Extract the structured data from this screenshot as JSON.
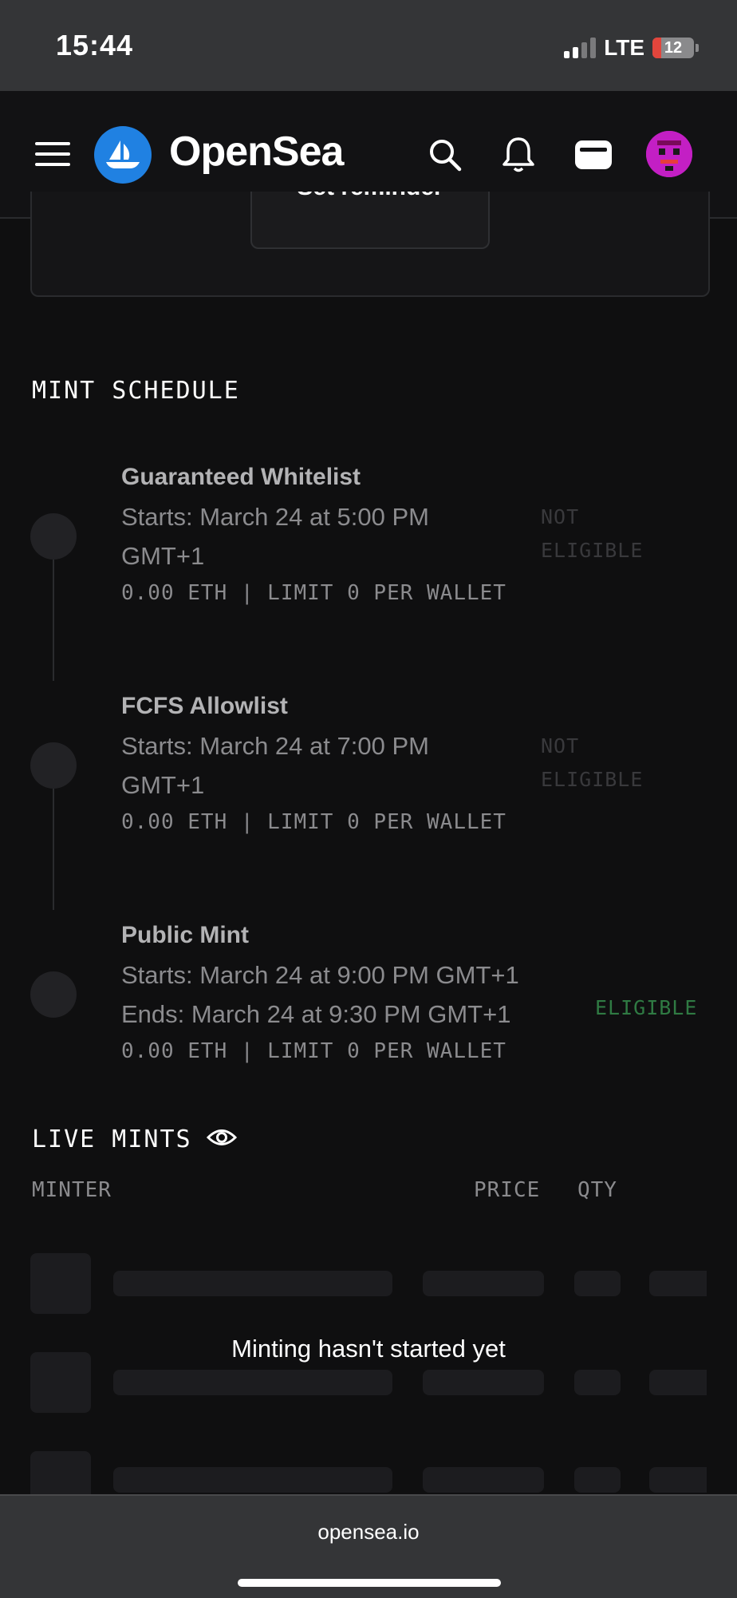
{
  "status_bar": {
    "time": "15:44",
    "network": "LTE",
    "battery": "12"
  },
  "nav": {
    "brand": "OpenSea",
    "icons": [
      "menu-icon",
      "search-icon",
      "bell-icon",
      "wallet-icon",
      "avatar"
    ]
  },
  "reminder": {
    "button_label": "Set reminder"
  },
  "mint_schedule": {
    "title": "MINT SCHEDULE",
    "phases": [
      {
        "name": "Guaranteed Whitelist",
        "line1": "Starts: March 24 at 5:00 PM",
        "line2": "GMT+1",
        "meta": "0.00 ETH | LIMIT 0 PER WALLET",
        "status_line1": "NOT",
        "status_line2": "ELIGIBLE"
      },
      {
        "name": "FCFS Allowlist",
        "line1": "Starts: March 24 at 7:00 PM",
        "line2": "GMT+1",
        "meta": "0.00 ETH | LIMIT 0 PER WALLET",
        "status_line1": "NOT",
        "status_line2": "ELIGIBLE"
      },
      {
        "name": "Public Mint",
        "line1": "Starts: March 24 at 9:00 PM GMT+1",
        "line2": "Ends: March 24 at 9:30 PM GMT+1",
        "meta": "0.00 ETH | LIMIT 0 PER WALLET",
        "status_line1": "ELIGIBLE",
        "status_line2": ""
      }
    ]
  },
  "live_mints": {
    "title": "LIVE MINTS",
    "columns": {
      "minter": "MINTER",
      "price": "PRICE",
      "qty": "QTY"
    },
    "empty_message": "Minting hasn't started yet"
  },
  "browser": {
    "url": "opensea.io"
  },
  "colors": {
    "accent": "#2081e2",
    "eligible": "#2f7a43",
    "avatar": "#c31fc4"
  }
}
